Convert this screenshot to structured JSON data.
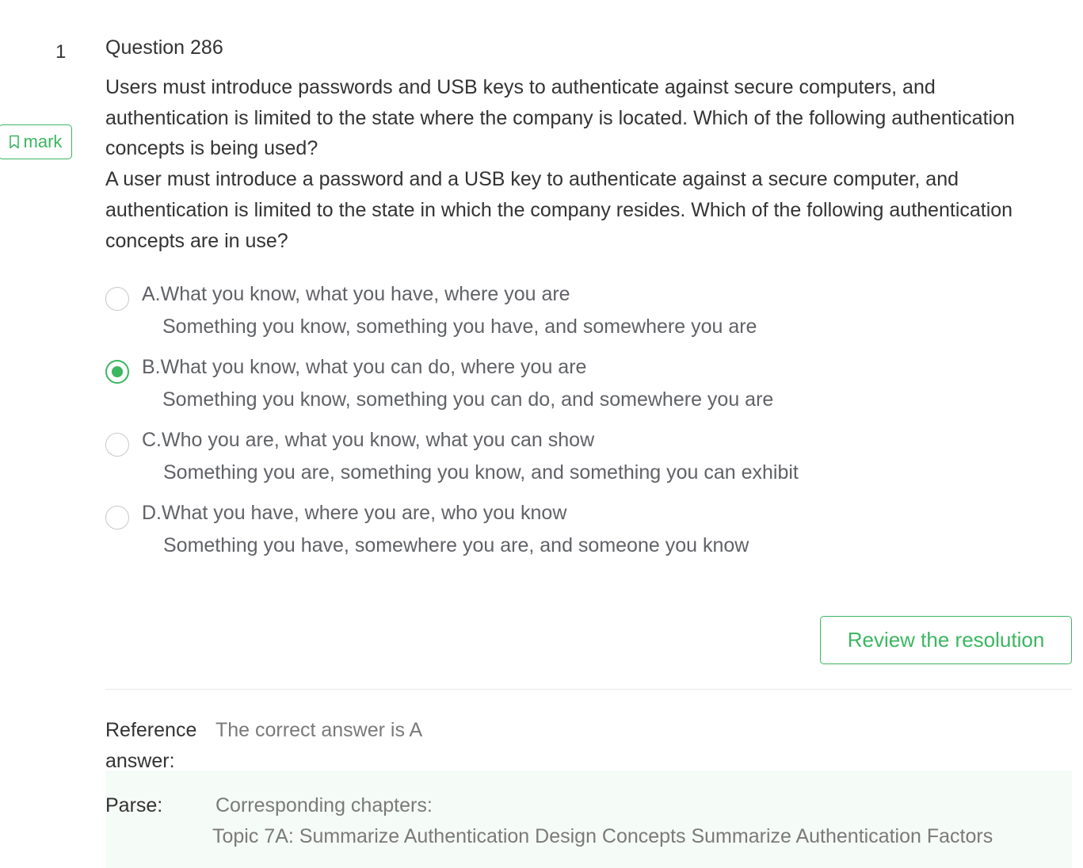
{
  "question": {
    "number": "1",
    "title": "Question 286",
    "mark_label": "mark",
    "text_primary": "Users must introduce passwords and USB keys to authenticate against secure computers, and authentication is limited to the state where the company is located. Which of the following authentication concepts is being used?",
    "text_secondary": "A user must introduce a password and a USB key to authenticate against a secure computer, and authentication is limited to the state in which the company resides. Which of the following authentication concepts are in use?"
  },
  "options": [
    {
      "label": "A.What you know, what you have, where you are",
      "sub": "Something you know, something you have, and somewhere you are",
      "selected": false
    },
    {
      "label": "B.What you know, what you can do, where you are",
      "sub": "Something you know, something you can do, and somewhere you are",
      "selected": true
    },
    {
      "label": "C.Who you are, what you know, what you can show",
      "sub": "Something you are, something you know, and something you can exhibit",
      "selected": false
    },
    {
      "label": "D.What you have, where you are, who you know",
      "sub": "Something you have, somewhere you are, and someone you know",
      "selected": false
    }
  ],
  "review_button_label": "Review the resolution",
  "reference": {
    "label": "Reference answer:",
    "value": "The correct answer is A"
  },
  "parse": {
    "label": "Parse:",
    "line1": "Corresponding chapters:",
    "line2": "Topic 7A: Summarize Authentication Design Concepts Summarize Authentication Factors"
  },
  "colors": {
    "accent": "#3cb661",
    "parse_bg": "#f5fbf7"
  },
  "icons": {
    "mark": "bookmark-icon"
  }
}
